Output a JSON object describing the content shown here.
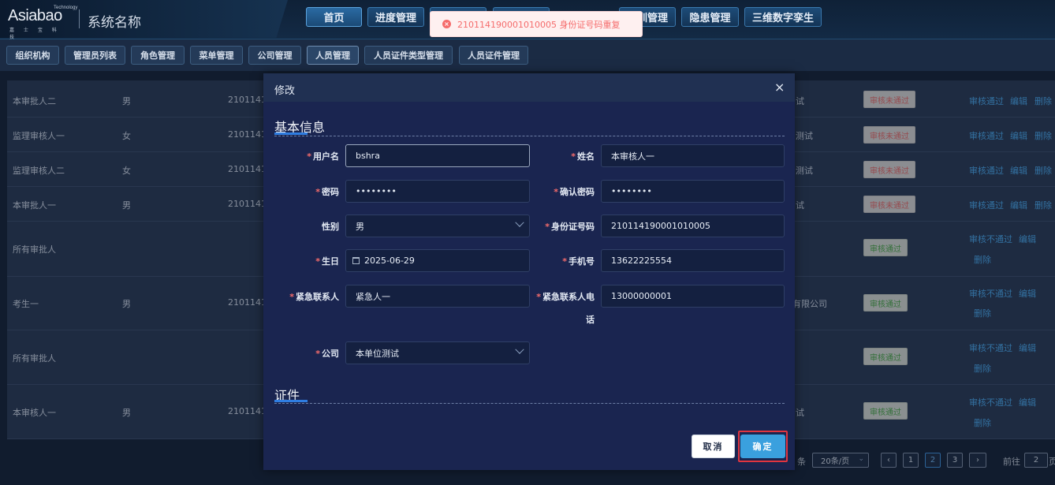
{
  "header": {
    "logo_text": "Asiabao",
    "logo_tech": "Technology",
    "logo_sub": "嘉 士 宝 科 技",
    "system_name": "系统名称",
    "nav": [
      "首页",
      "进度管理",
      "",
      "",
      "训管理",
      "隐患管理",
      "三维数字孪生"
    ]
  },
  "toast": {
    "message": "210114190001010005 身份证号码重复"
  },
  "subtabs": [
    "组织机构",
    "管理员列表",
    "角色管理",
    "菜单管理",
    "公司管理",
    "人员管理",
    "人员证件类型管理",
    "人员证件管理"
  ],
  "table": {
    "rows": [
      {
        "name": "本审批人二",
        "gender": "男",
        "id": "2101141",
        "company": "试",
        "status": "审核未通过",
        "status_type": "fail",
        "actions": [
          "审核通过",
          "编辑",
          "删除"
        ]
      },
      {
        "name": "监理审核人一",
        "gender": "女",
        "id": "2101141",
        "company": "测试",
        "status": "审核未通过",
        "status_type": "fail",
        "actions": [
          "审核通过",
          "编辑",
          "删除"
        ]
      },
      {
        "name": "监理审核人二",
        "gender": "女",
        "id": "2101141",
        "company": "测试",
        "status": "审核未通过",
        "status_type": "fail",
        "actions": [
          "审核通过",
          "编辑",
          "删除"
        ]
      },
      {
        "name": "本审批人一",
        "gender": "男",
        "id": "2101141",
        "company": "试",
        "status": "审核未通过",
        "status_type": "fail",
        "actions": [
          "审核通过",
          "编辑",
          "删除"
        ]
      },
      {
        "name": "所有审批人",
        "gender": "",
        "id": "",
        "company": "",
        "status": "审核通过",
        "status_type": "pass",
        "actions": [
          "审核不通过",
          "编辑",
          "删除"
        ]
      },
      {
        "name": "考生一",
        "gender": "男",
        "id": "2101141",
        "company": "有限公司",
        "status": "审核通过",
        "status_type": "pass",
        "actions": [
          "审核不通过",
          "编辑",
          "删除"
        ]
      },
      {
        "name": "所有审批人",
        "gender": "",
        "id": "",
        "company": "",
        "status": "审核通过",
        "status_type": "pass",
        "actions": [
          "审核不通过",
          "编辑",
          "删除"
        ]
      },
      {
        "name": "本审核人一",
        "gender": "男",
        "id": "2101141",
        "company": "试",
        "status": "审核通过",
        "status_type": "pass",
        "actions": [
          "审核不通过",
          "编辑",
          "删除"
        ]
      }
    ]
  },
  "pagination": {
    "total_suffix": "条",
    "page_size": "20条/页",
    "prev": "‹",
    "pages": [
      "1",
      "2",
      "3"
    ],
    "current_page": "2",
    "next": "›",
    "goto_label": "前往",
    "goto_value": "2",
    "goto_suffix": "页"
  },
  "dialog": {
    "title": "修改",
    "close": "×",
    "section_basic": "基本信息",
    "section_cert": "证件",
    "fields": {
      "username": {
        "label": "用户名",
        "value": "bshra"
      },
      "realname": {
        "label": "姓名",
        "value": "本审核人一"
      },
      "password": {
        "label": "密码",
        "value": "••••••••"
      },
      "confirm_password": {
        "label": "确认密码",
        "value": "••••••••"
      },
      "gender": {
        "label": "性别",
        "value": "男"
      },
      "id_number": {
        "label": "身份证号码",
        "value": "210114190001010005"
      },
      "birthday": {
        "label": "生日",
        "value": "2025-06-29"
      },
      "phone": {
        "label": "手机号",
        "value": "13622225554"
      },
      "emergency_contact": {
        "label": "紧急联系人",
        "value": "紧急人一"
      },
      "emergency_phone": {
        "label_line1": "紧急联系人电",
        "label_line2": "话",
        "value": "13000000001"
      },
      "company": {
        "label": "公司",
        "value": "本单位测试"
      }
    },
    "cancel_label": "取消",
    "ok_label": "确定"
  }
}
